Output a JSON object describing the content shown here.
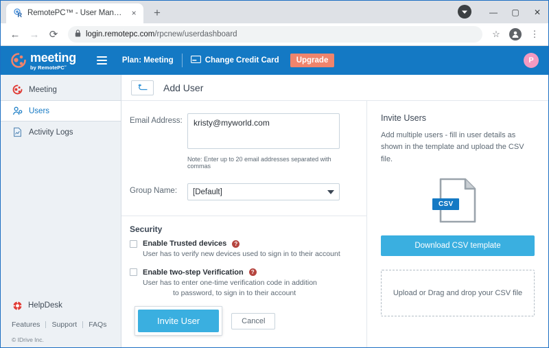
{
  "browser": {
    "tab": {
      "title": "RemotePC™ - User Management",
      "favicon": "remotepc-favicon",
      "close": "×"
    },
    "newtab_label": "+",
    "window_controls": {
      "minimize": "—",
      "maximize": "▢",
      "close": "✕",
      "profile": "profile-chip"
    },
    "nav": {
      "back": "←",
      "forward": "→",
      "reload": "⟳"
    },
    "address": {
      "lock": "lock-icon",
      "host": "login.remotepc.com",
      "path": "/rpcnew/userdashboard"
    },
    "toolbar_right": {
      "bookmark": "☆",
      "profile": "account-avatar",
      "menu": "⋮"
    }
  },
  "appbar": {
    "logo_main": "meeting",
    "logo_sub": "by RemotePC˜",
    "menu_icon": "hamburger-icon",
    "plan": "Plan: Meeting",
    "change_card": "Change Credit Card",
    "card_icon": "credit-card-icon",
    "upgrade": "Upgrade",
    "avatar_initial": "P",
    "bg": "#1479c4",
    "upgrade_bg": "#f0846c",
    "avatar_bg": "#f49ac1"
  },
  "sidebar": {
    "items": [
      {
        "label": "Meeting",
        "icon": "meeting-icon",
        "active": false
      },
      {
        "label": "Users",
        "icon": "users-icon",
        "active": true
      },
      {
        "label": "Activity Logs",
        "icon": "activity-logs-icon",
        "active": false
      }
    ],
    "helpdesk": {
      "label": "HelpDesk",
      "icon": "lifebuoy-icon"
    },
    "links": [
      "Features",
      "Support",
      "FAQs"
    ],
    "copyright": "© IDrive Inc."
  },
  "content": {
    "back_icon": "back-arrow-icon",
    "page_title": "Add User",
    "form": {
      "email_label": "Email Address:",
      "email_value": "kristy@myworld.com",
      "email_note": "Note: Enter up to 20 email addresses separated with commas",
      "group_label": "Group Name:",
      "group_value": "[Default]",
      "group_options": [
        "[Default]"
      ]
    },
    "security": {
      "title": "Security",
      "options": [
        {
          "label": "Enable Trusted devices",
          "checked": false,
          "help": "?",
          "desc": "User has to verify new devices used to sign in to their account",
          "desc2": ""
        },
        {
          "label": "Enable two-step Verification",
          "checked": false,
          "help": "?",
          "desc": "User has to enter one-time verification code in addition",
          "desc2": "to password, to sign in to their account"
        }
      ]
    },
    "actions": {
      "primary": "Invite User",
      "secondary": "Cancel",
      "primary_bg": "#3aafe0"
    }
  },
  "invite_panel": {
    "title": "Invite Users",
    "description": "Add multiple users - fill in user details as shown in the template and upload the CSV file.",
    "csv_badge": "CSV",
    "csv_icon": "csv-file-icon",
    "download_button": "Download CSV template",
    "dropzone": "Upload or Drag and drop your CSV file"
  }
}
